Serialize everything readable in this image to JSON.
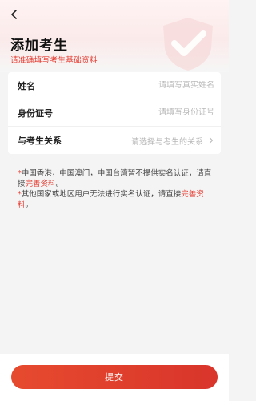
{
  "header": {
    "title": "添加考生",
    "subtitle": "请准确填写考生基础资料"
  },
  "form": {
    "fields": [
      {
        "label": "姓名",
        "placeholder": "请填写真实姓名",
        "value": ""
      },
      {
        "label": "身份证号",
        "placeholder": "请填写身份证号",
        "value": ""
      },
      {
        "label": "与考生关系",
        "placeholder": "请选择与考生的关系",
        "value": ""
      }
    ]
  },
  "notes": {
    "note1_text": "中国香港，中国澳门，中国台湾暂不提供实名认证，请直接",
    "note1_link": "完善资料",
    "note1_end": "。",
    "note2_text": "其他国家或地区用户无法进行实名认证，请直接",
    "note2_link": "完善资料",
    "note2_end": "。",
    "star": "*"
  },
  "submit_label": "提交",
  "colors": {
    "accent": "#e53a2f",
    "button": "#e0402c"
  },
  "icons": {
    "back": "chevron-left-icon",
    "relation_arrow": "chevron-right-icon",
    "decor": "shield-check-icon"
  }
}
